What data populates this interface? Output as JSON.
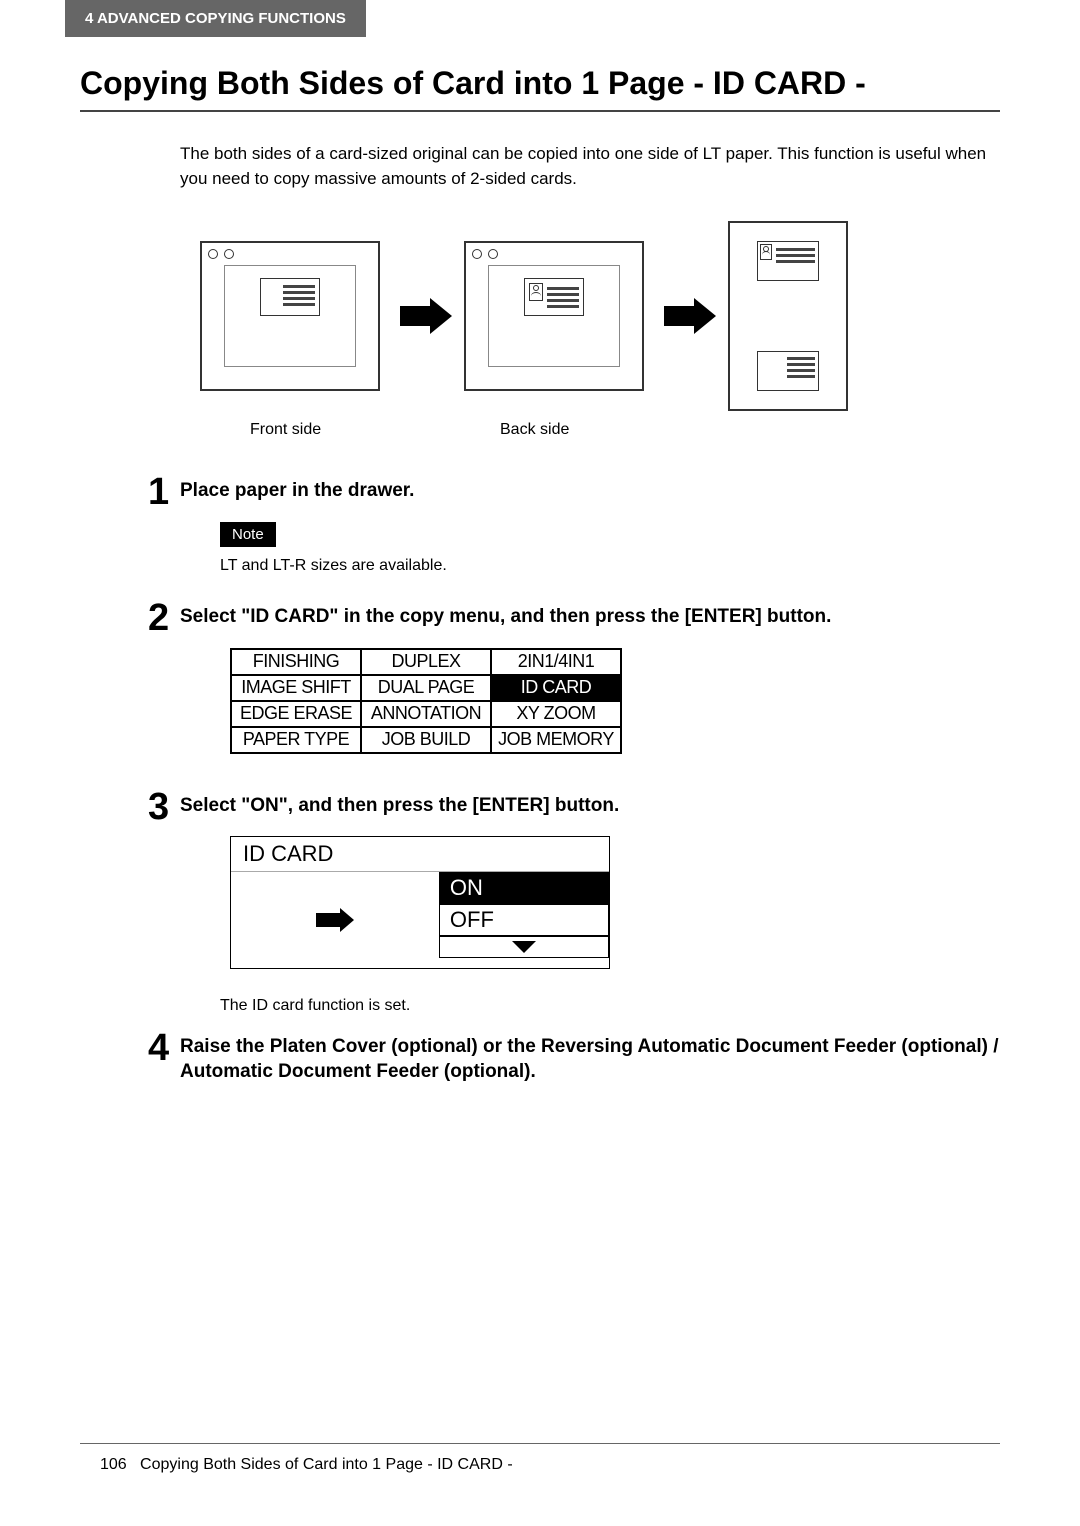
{
  "header": {
    "tab": "4   ADVANCED COPYING FUNCTIONS"
  },
  "title": "Copying Both Sides of Card into 1 Page - ID CARD -",
  "intro": "The both sides of a card-sized original can be copied into one side of LT paper. This function is useful when you need to copy massive amounts of 2-sided cards.",
  "scanner_labels": {
    "front": "Front side",
    "back": "Back side"
  },
  "steps": {
    "s1": {
      "num": "1",
      "title": "Place paper in the drawer.",
      "note_label": "Note",
      "note_text": "LT and LT-R sizes are available."
    },
    "s2": {
      "num": "2",
      "title": "Select \"ID CARD\" in the copy menu, and then press the [ENTER] button.",
      "menu": [
        [
          "FINISHING",
          "DUPLEX",
          "2IN1/4IN1"
        ],
        [
          "IMAGE SHIFT",
          "DUAL PAGE",
          "ID CARD"
        ],
        [
          "EDGE ERASE",
          "ANNOTATION",
          "XY ZOOM"
        ],
        [
          "PAPER TYPE",
          "JOB BUILD",
          "JOB MEMORY"
        ]
      ],
      "selected": "ID CARD"
    },
    "s3": {
      "num": "3",
      "title": "Select \"ON\", and then press the [ENTER] button.",
      "lcd_title": "ID CARD",
      "options": [
        "ON",
        "OFF"
      ],
      "selected": "ON",
      "result": "The ID card function is set."
    },
    "s4": {
      "num": "4",
      "title": "Raise the Platen Cover (optional) or the Reversing Automatic Document Feeder (optional) / Automatic Document Feeder (optional)."
    }
  },
  "footer": {
    "page_num": "106",
    "page_title": "Copying Both Sides of Card into 1 Page - ID CARD -"
  }
}
